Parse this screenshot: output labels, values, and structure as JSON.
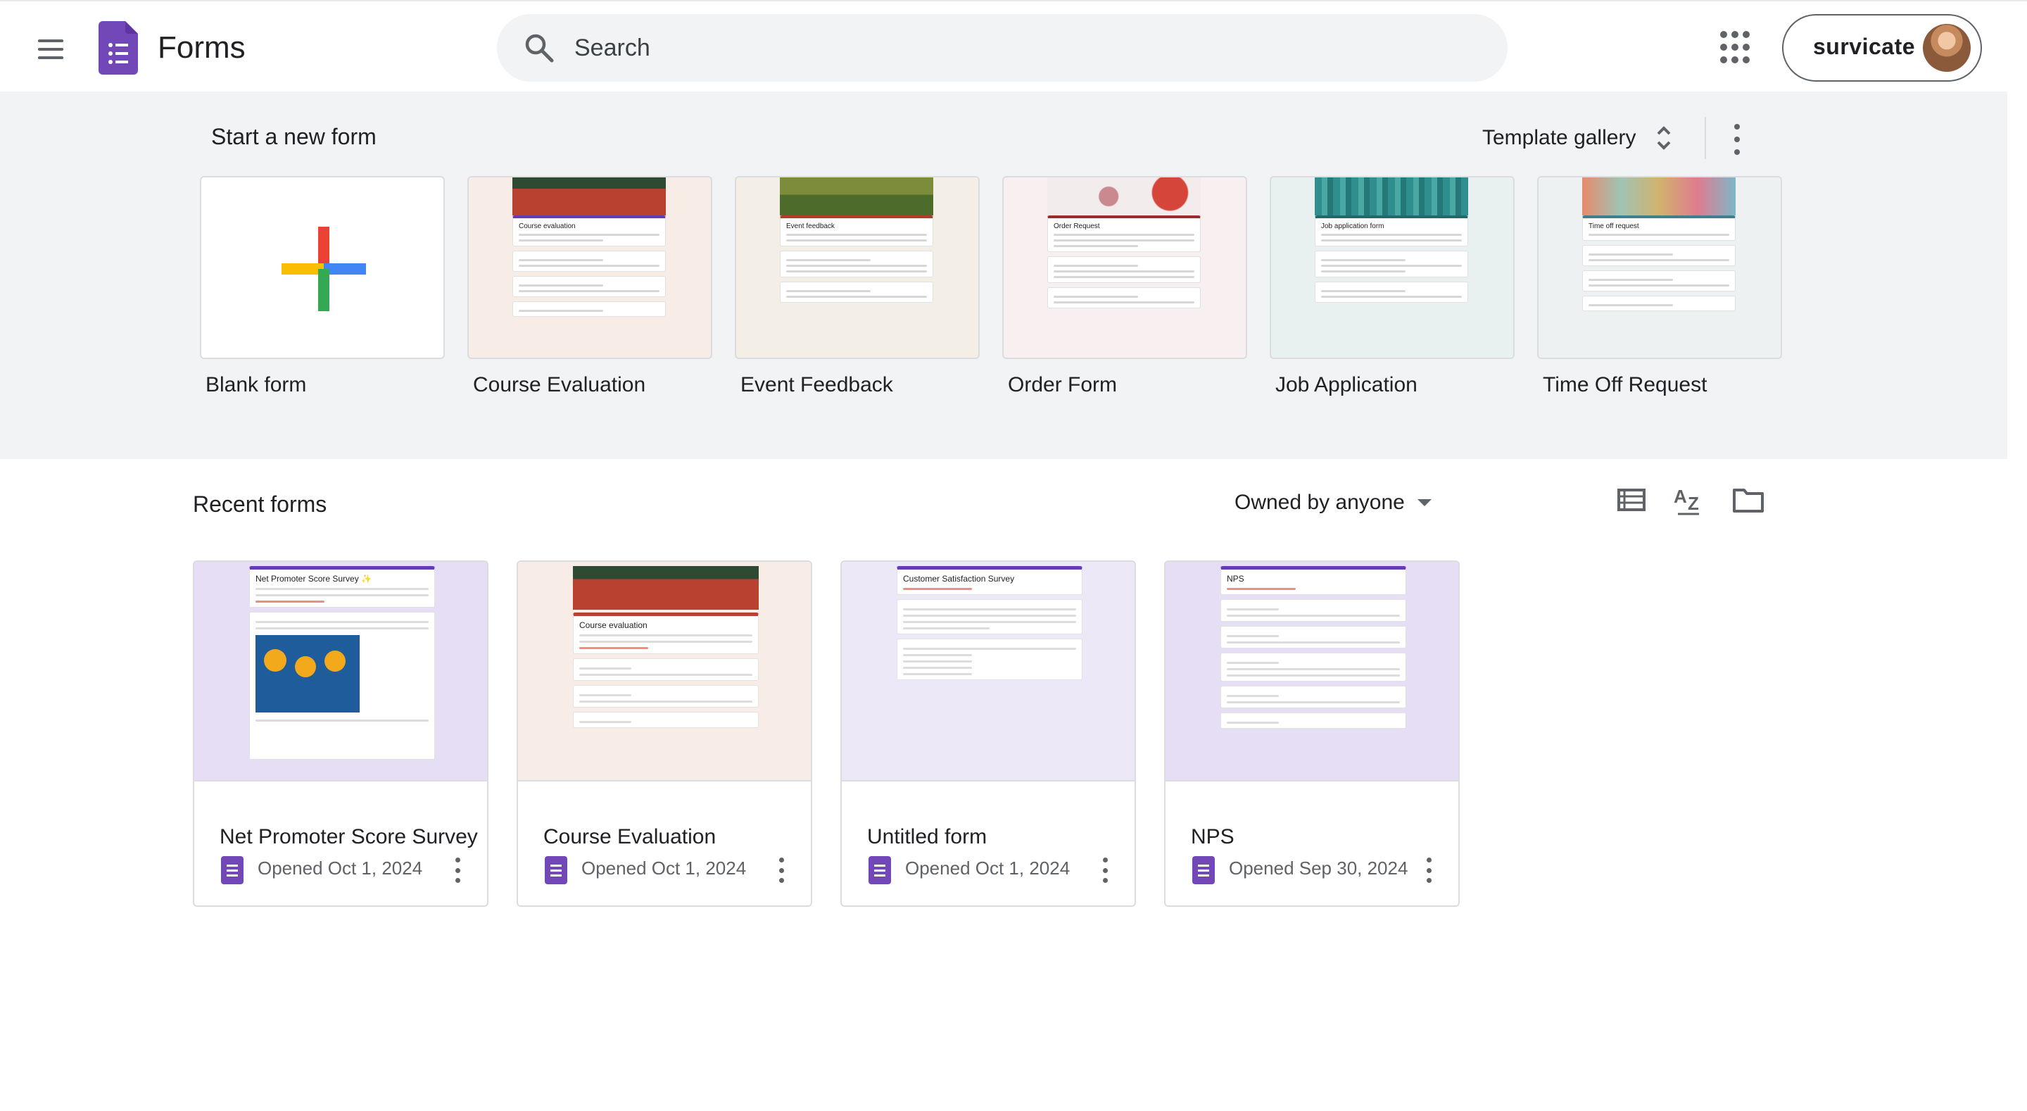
{
  "header": {
    "app_title": "Forms",
    "search_placeholder": "Search",
    "account_name": "survicate"
  },
  "start": {
    "title": "Start a new form",
    "template_gallery_label": "Template gallery",
    "templates": [
      {
        "label": "Blank form"
      },
      {
        "label": "Course Evaluation",
        "preview_title": "Course evaluation"
      },
      {
        "label": "Event Feedback",
        "preview_title": "Event feedback"
      },
      {
        "label": "Order Form",
        "preview_title": "Order Request"
      },
      {
        "label": "Job Application",
        "preview_title": "Job application form"
      },
      {
        "label": "Time Off Request",
        "preview_title": "Time off request"
      }
    ]
  },
  "recent": {
    "title": "Recent forms",
    "owner_filter": "Owned by anyone",
    "forms": [
      {
        "name": "Net Promoter Score Survey",
        "opened": "Opened Oct 1, 2024",
        "preview_title": "Net Promoter Score Survey ✨"
      },
      {
        "name": "Course Evaluation",
        "opened": "Opened Oct 1, 2024",
        "preview_title": "Course evaluation"
      },
      {
        "name": "Untitled form",
        "opened": "Opened Oct 1, 2024",
        "preview_title": "Customer Satisfaction Survey"
      },
      {
        "name": "NPS",
        "opened": "Opened Sep 30, 2024",
        "preview_title": "NPS"
      }
    ]
  },
  "colors": {
    "forms_purple": "#673ab7",
    "band_bg": "#f1f3f4",
    "plus_red": "#ea4335",
    "plus_blue": "#4285f4",
    "plus_yellow": "#fbbc04",
    "plus_green": "#34a853"
  },
  "icons": [
    "menu-icon",
    "forms-logo-icon",
    "search-icon",
    "apps-grid-icon",
    "unfold-icon",
    "more-vert-icon",
    "list-view-icon",
    "sort-az-icon",
    "folder-icon",
    "forms-file-icon"
  ]
}
